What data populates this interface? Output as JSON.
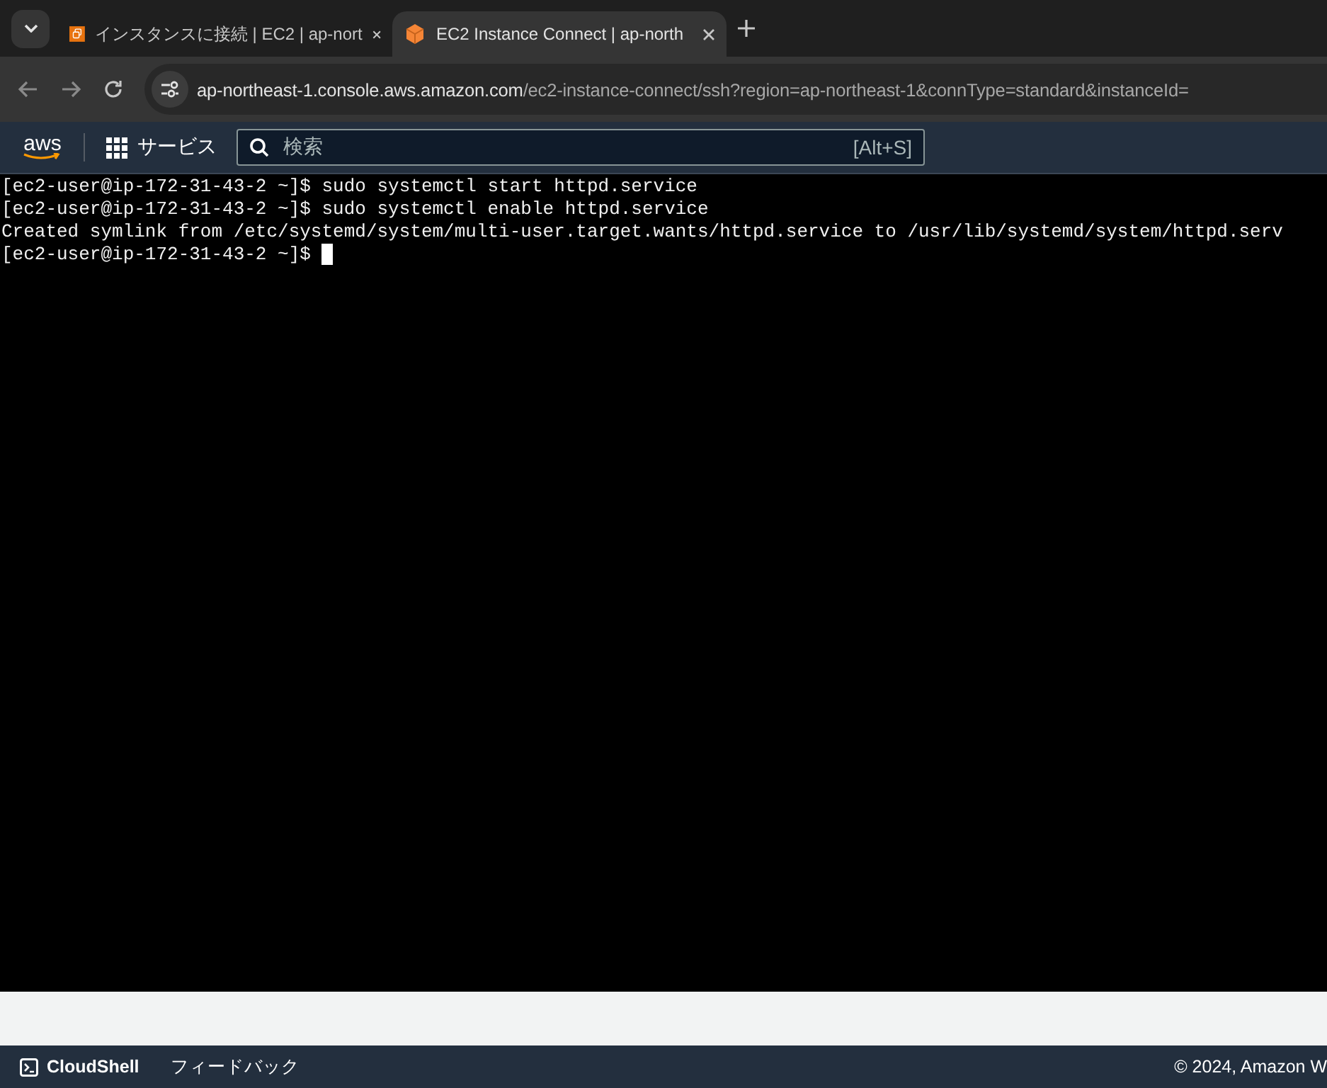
{
  "tabs": [
    {
      "title": "インスタンスに接続 | EC2 | ap-nort",
      "selected": false
    },
    {
      "title": "EC2 Instance Connect | ap-north",
      "selected": true
    }
  ],
  "address_bar": {
    "url_host": "ap-northeast-1.console.aws.amazon.com",
    "url_path": "/ec2-instance-connect/ssh?region=ap-northeast-1&connType=standard&instanceId="
  },
  "aws_nav": {
    "logo": "aws",
    "services": "サービス",
    "search": {
      "placeholder": "検索",
      "shortcut": "[Alt+S]"
    }
  },
  "terminal": {
    "lines": [
      {
        "prompt": "[ec2-user@ip-172-31-43-2 ~]$",
        "command": "sudo systemctl start httpd.service"
      },
      {
        "prompt": "[ec2-user@ip-172-31-43-2 ~]$",
        "command": "sudo systemctl enable httpd.service"
      },
      {
        "output": "Created symlink from /etc/systemd/system/multi-user.target.wants/httpd.service to /usr/lib/systemd/system/httpd.serv"
      },
      {
        "prompt": "[ec2-user@ip-172-31-43-2 ~]$",
        "cursor": true
      }
    ]
  },
  "footer": {
    "cloudshell": "CloudShell",
    "feedback": "フィードバック",
    "copyright": "© 2024, Amazon W"
  }
}
